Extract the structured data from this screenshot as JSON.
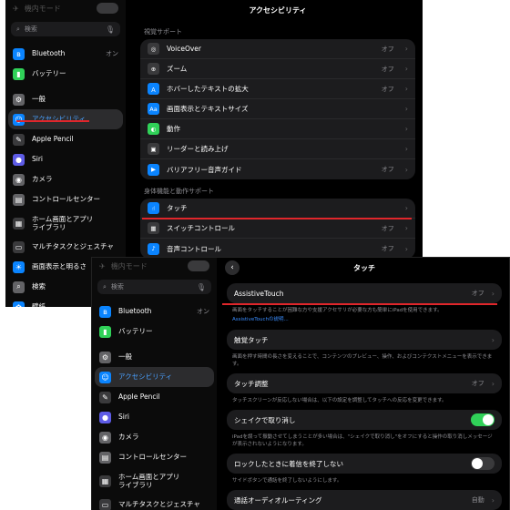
{
  "shot1": {
    "sidebar": {
      "airplane": "機内モード",
      "search": "検索",
      "items": [
        {
          "label": "Bluetooth",
          "value": "オン",
          "icon": "bluetooth-icon",
          "color": "#0a84ff",
          "glyph": "ʙ"
        },
        {
          "label": "バッテリー",
          "icon": "battery-icon",
          "color": "#30d158",
          "glyph": "▮"
        },
        {
          "label": "一般",
          "icon": "gear-icon",
          "color": "#636366",
          "glyph": "⚙"
        },
        {
          "label": "アクセシビリティ",
          "icon": "accessibility-icon",
          "color": "#0a84ff",
          "glyph": "☺"
        },
        {
          "label": "Apple Pencil",
          "icon": "pencil-icon",
          "color": "#3a3a3c",
          "glyph": "✎"
        },
        {
          "label": "Siri",
          "icon": "siri-icon",
          "color": "#5e5ce6",
          "glyph": "●"
        },
        {
          "label": "カメラ",
          "icon": "camera-icon",
          "color": "#636366",
          "glyph": "◉"
        },
        {
          "label": "コントロールセンター",
          "icon": "control-center-icon",
          "color": "#636366",
          "glyph": "▤"
        },
        {
          "label": "ホーム画面とアプリ\nライブラリ",
          "icon": "home-screen-icon",
          "color": "#3a3a3c",
          "glyph": "▦"
        },
        {
          "label": "マルチタスクとジェスチャ",
          "icon": "multitask-icon",
          "color": "#3a3a3c",
          "glyph": "▭"
        },
        {
          "label": "画面表示と明るさ",
          "icon": "brightness-icon",
          "color": "#0a84ff",
          "glyph": "☀"
        },
        {
          "label": "検索",
          "icon": "search-icon",
          "color": "#636366",
          "glyph": "⌕"
        },
        {
          "label": "壁紙",
          "icon": "wallpaper-icon",
          "color": "#0a84ff",
          "glyph": "✿"
        }
      ]
    },
    "main": {
      "title": "アクセシビリティ",
      "vision_header": "視覚サポート",
      "vision": [
        {
          "label": "VoiceOver",
          "value": "オフ",
          "icon": "voiceover-icon",
          "color": "#3a3a3c",
          "glyph": "◎"
        },
        {
          "label": "ズーム",
          "value": "オフ",
          "icon": "zoom-icon",
          "color": "#3a3a3c",
          "glyph": "⊕"
        },
        {
          "label": "ホバーしたテキストの拡大",
          "value": "オフ",
          "icon": "hover-text-icon",
          "color": "#0a84ff",
          "glyph": "Ａ"
        },
        {
          "label": "画面表示とテキストサイズ",
          "value": "",
          "icon": "text-size-icon",
          "color": "#0a84ff",
          "glyph": "Aa"
        },
        {
          "label": "動作",
          "value": "",
          "icon": "motion-icon",
          "color": "#30d158",
          "glyph": "◐"
        },
        {
          "label": "リーダーと読み上げ",
          "value": "",
          "icon": "speech-icon",
          "color": "#3a3a3c",
          "glyph": "▣"
        },
        {
          "label": "バリアフリー音声ガイド",
          "value": "オフ",
          "icon": "audio-description-icon",
          "color": "#0a84ff",
          "glyph": "▶"
        }
      ],
      "physical_header": "身体機能と動作サポート",
      "physical": [
        {
          "label": "タッチ",
          "value": "",
          "icon": "touch-icon",
          "color": "#0a84ff",
          "glyph": "☝"
        },
        {
          "label": "スイッチコントロール",
          "value": "オフ",
          "icon": "switch-control-icon",
          "color": "#3a3a3c",
          "glyph": "▦"
        },
        {
          "label": "音声コントロール",
          "value": "オフ",
          "icon": "voice-control-icon",
          "color": "#0a84ff",
          "glyph": "♪"
        }
      ]
    }
  },
  "shot2": {
    "sidebar": {
      "airplane": "機内モード",
      "search": "検索",
      "items": [
        {
          "label": "Bluetooth",
          "value": "オン",
          "icon": "bluetooth-icon",
          "color": "#0a84ff",
          "glyph": "ʙ"
        },
        {
          "label": "バッテリー",
          "icon": "battery-icon",
          "color": "#30d158",
          "glyph": "▮"
        },
        {
          "label": "一般",
          "icon": "gear-icon",
          "color": "#636366",
          "glyph": "⚙"
        },
        {
          "label": "アクセシビリティ",
          "icon": "accessibility-icon",
          "color": "#0a84ff",
          "glyph": "☺"
        },
        {
          "label": "Apple Pencil",
          "icon": "pencil-icon",
          "color": "#3a3a3c",
          "glyph": "✎"
        },
        {
          "label": "Siri",
          "icon": "siri-icon",
          "color": "#5e5ce6",
          "glyph": "●"
        },
        {
          "label": "カメラ",
          "icon": "camera-icon",
          "color": "#636366",
          "glyph": "◉"
        },
        {
          "label": "コントロールセンター",
          "icon": "control-center-icon",
          "color": "#636366",
          "glyph": "▤"
        },
        {
          "label": "ホーム画面とアプリ\nライブラリ",
          "icon": "home-screen-icon",
          "color": "#3a3a3c",
          "glyph": "▦"
        },
        {
          "label": "マルチタスクとジェスチャ",
          "icon": "multitask-icon",
          "color": "#3a3a3c",
          "glyph": "▭"
        }
      ]
    },
    "main": {
      "title": "タッチ",
      "assistive": {
        "label": "AssistiveTouch",
        "value": "オフ",
        "footer": "画面をタッチすることが困難な方や支援アクセサリが必要な方も簡単にiPadを使用できます。",
        "link": "AssistiveTouchの説明..."
      },
      "haptic": {
        "label": "触覚タッチ"
      },
      "haptic_footer": "画面を押す時間の長さを変えることで、コンテンツのプレビュー、操作、およびコンテクストメニューを表示できます。",
      "accommodations": {
        "label": "タッチ調整",
        "value": "オフ",
        "footer": "タッチスクリーンが反応しない場合は、以下の設定を調整してタッチへの反応を変更できます。"
      },
      "shake": {
        "label": "シェイクで取り消し",
        "on": true,
        "footer": "iPadを誤って振動させてしまうことが多い場合は、\"シェイクで取り消し\"をオフにすると操作の取り消しメッセージが表示されないようになります。"
      },
      "lock": {
        "label": "ロックしたときに着信を終了しない",
        "on": false,
        "footer": "サイドボタンで通話を終了しないようにします。"
      },
      "audio_routing": {
        "label": "通話オーディオルーティング",
        "value": "自動"
      }
    }
  }
}
